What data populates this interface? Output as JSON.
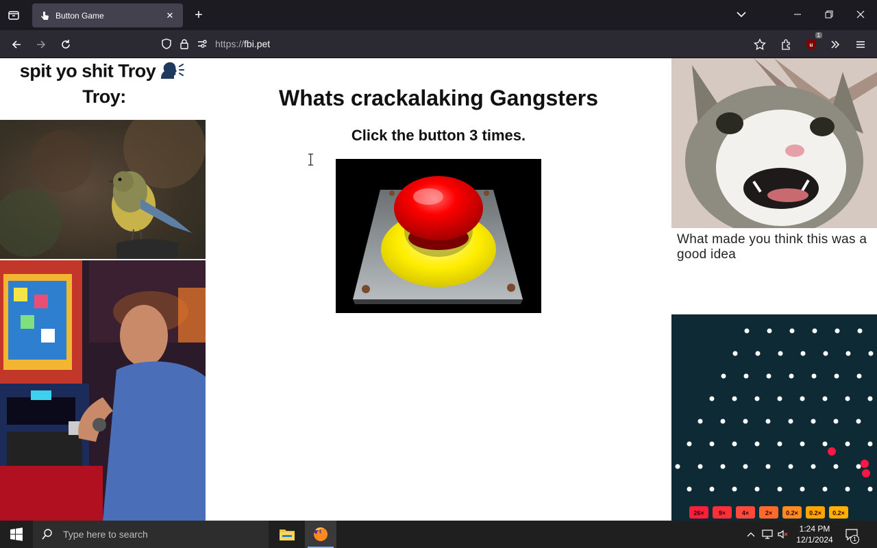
{
  "browser": {
    "tab_title": "Button Game",
    "url_prefix": "https://",
    "url_host": "fbi.pet",
    "extension_badge": "1"
  },
  "page": {
    "meme_caption_line1": "spit yo shit Troy",
    "meme_caption_line2": "Troy:",
    "heading": "Whats crackalaking Gangsters",
    "subheading": "Click the button 3 times.",
    "cat_caption": "What made you think this was a good idea",
    "plinko_multipliers": [
      "26×",
      "9×",
      "4×",
      "2×",
      "0.2×",
      "0.2×",
      "0.2×"
    ]
  },
  "taskbar": {
    "search_placeholder": "Type here to search",
    "time": "1:24 PM",
    "date": "12/1/2024",
    "notification_count": "1"
  },
  "colors": {
    "tabbar_bg": "#1c1b22",
    "navbar_bg": "#2b2a33",
    "button_red": "#e00000",
    "button_yellow": "#ffee00",
    "plinko_bg": "#0e2a35"
  }
}
